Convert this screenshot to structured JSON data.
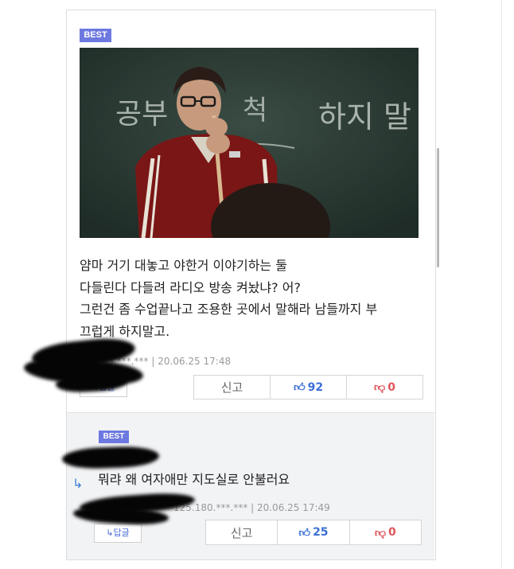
{
  "best_comment": {
    "badge": "BEST",
    "image_alt": "teacher-at-chalkboard-photo",
    "chalkboard_text_left": "공부",
    "chalkboard_text_mid": "척",
    "chalkboard_text_right": "하지 말",
    "lines": [
      "얌마 거기 대놓고 야한거 이야기하는 둘",
      "다들린다 다들려 라디오 방송 켜놨냐? 어?",
      "그런건 좀 수업끝나고 조용한 곳에서 말해라 남들까지 부",
      "끄럽게 하지말고."
    ],
    "ip_partial": "203.***.***",
    "date": "20.06.25 17:48",
    "reply_label": "↳답글",
    "report_label": "신고",
    "likes": "92",
    "dislikes": "0"
  },
  "reply_comment": {
    "badge": "BEST",
    "text": "뭐랴 왜 여자애만 지도실로 안불러요",
    "ip_partial": "125.180.***.***",
    "date": "20.06.25 17:49",
    "reply_label": "↳답글",
    "report_label": "신고",
    "likes": "25",
    "dislikes": "0"
  },
  "separator": "|",
  "colors": {
    "badge": "#6d79e0",
    "like": "#3c6fd6",
    "dislike": "#e0565a",
    "reply_bg": "#f2f3f5"
  }
}
